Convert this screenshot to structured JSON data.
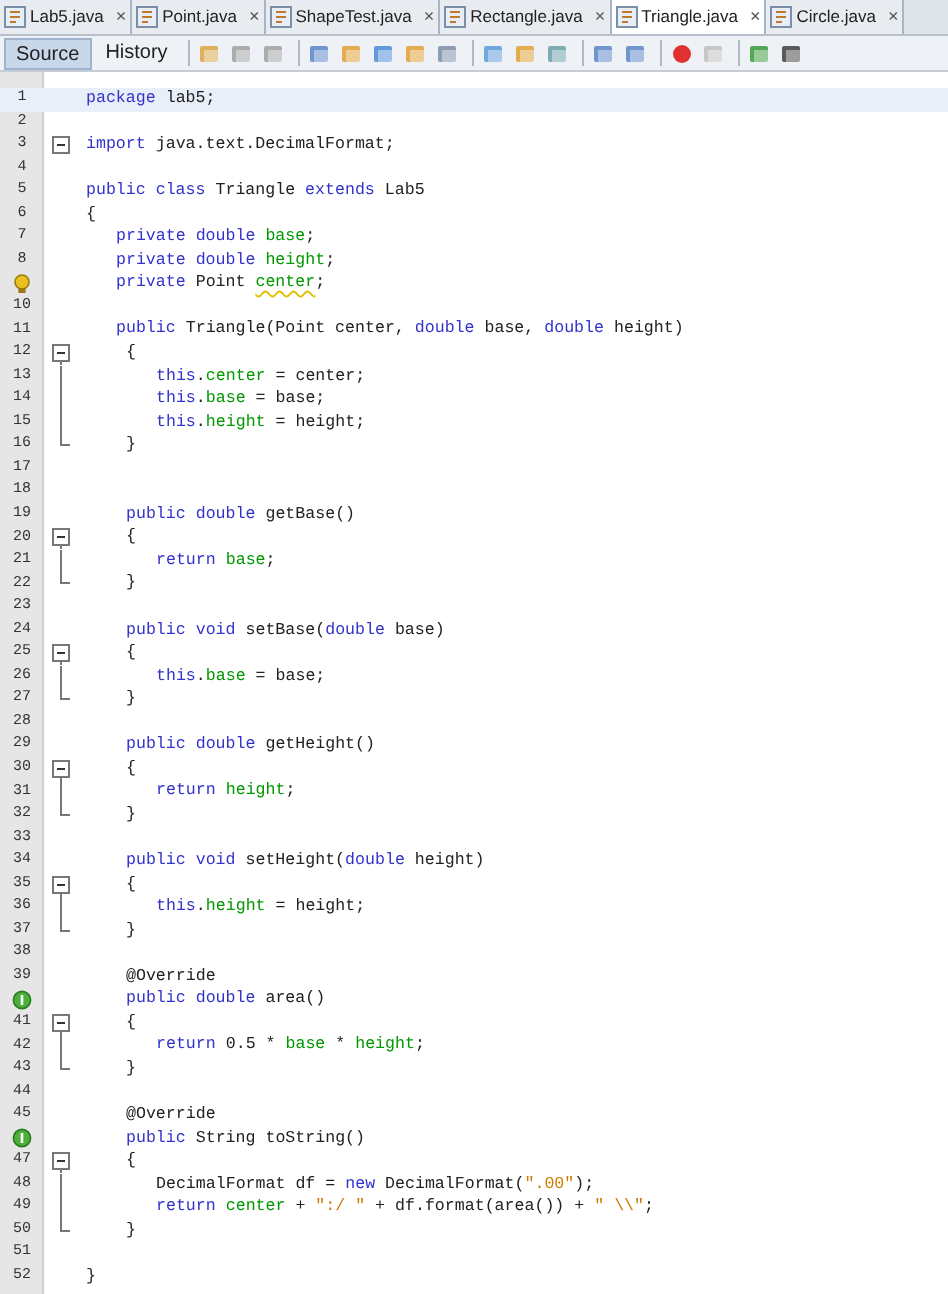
{
  "tabs": [
    {
      "label": "Lab5.java",
      "close": "×",
      "selected": false
    },
    {
      "label": "Point.java",
      "close": "×",
      "selected": false
    },
    {
      "label": "ShapeTest.java",
      "close": "×",
      "selected": false
    },
    {
      "label": "Rectangle.java",
      "close": "×",
      "selected": false
    },
    {
      "label": "Triangle.java",
      "close": "×",
      "selected": true
    },
    {
      "label": "Circle.java",
      "close": "×",
      "selected": false
    }
  ],
  "view_tabs": [
    {
      "label": "Source",
      "selected": true
    },
    {
      "label": "History",
      "selected": false
    }
  ],
  "lines": [
    {
      "number": "1",
      "current": true,
      "tokens": [
        {
          "kind": "kw",
          "text": "package "
        },
        {
          "kind": "plain",
          "text": "lab5;"
        }
      ]
    },
    {
      "number": "2",
      "current": false
    },
    {
      "number": "3",
      "current": false,
      "fold": {
        "kind": "single"
      },
      "tokens": [
        {
          "kind": "kw",
          "text": "import "
        },
        {
          "kind": "plain",
          "text": "java.text.DecimalFormat;"
        }
      ]
    },
    {
      "number": "4",
      "current": false
    },
    {
      "number": "5",
      "current": false,
      "tokens": [
        {
          "kind": "kw",
          "text": "public class "
        },
        {
          "kind": "plain",
          "text": "Triangle "
        },
        {
          "kind": "kw",
          "text": "extends "
        },
        {
          "kind": "plain",
          "text": "Lab5"
        }
      ]
    },
    {
      "number": "6",
      "current": false,
      "tokens": [
        {
          "kind": "plain",
          "text": "{"
        }
      ]
    },
    {
      "number": "7",
      "current": false,
      "indent": {
        "kind": "member"
      },
      "tokens": [
        {
          "kind": "kw",
          "text": "private double "
        },
        {
          "kind": "field",
          "text": "base"
        },
        {
          "kind": "plain",
          "text": ";"
        }
      ]
    },
    {
      "number": "8",
      "current": false,
      "indent": {
        "kind": "member"
      },
      "tokens": [
        {
          "kind": "kw",
          "text": "private double "
        },
        {
          "kind": "field",
          "text": "height"
        },
        {
          "kind": "plain",
          "text": ";"
        }
      ]
    },
    {
      "current": false,
      "marker": {
        "kind": "warning"
      },
      "indent": {
        "kind": "member"
      },
      "tokens": [
        {
          "kind": "kw",
          "text": "private "
        },
        {
          "kind": "plain",
          "text": "Point "
        },
        {
          "kind": "warn",
          "text": "center"
        },
        {
          "kind": "plain",
          "text": ";"
        }
      ]
    },
    {
      "number": "10",
      "current": false
    },
    {
      "number": "11",
      "current": false,
      "indent": {
        "kind": "member"
      },
      "tokens": [
        {
          "kind": "kw",
          "text": "public "
        },
        {
          "kind": "plain",
          "text": "Triangle(Point center, "
        },
        {
          "kind": "kw",
          "text": "double "
        },
        {
          "kind": "plain",
          "text": "base, "
        },
        {
          "kind": "kw",
          "text": "double "
        },
        {
          "kind": "plain",
          "text": "height)"
        }
      ]
    },
    {
      "number": "12",
      "current": false,
      "fold": {
        "kind": "start"
      },
      "indent": {
        "kind": "method"
      },
      "tokens": [
        {
          "kind": "plain",
          "text": "{"
        }
      ]
    },
    {
      "number": "13",
      "current": false,
      "fold": {
        "kind": "body"
      },
      "indent": {
        "kind": "body"
      },
      "tokens": [
        {
          "kind": "kw",
          "text": "this"
        },
        {
          "kind": "plain",
          "text": "."
        },
        {
          "kind": "field",
          "text": "center"
        },
        {
          "kind": "plain",
          "text": " = center;"
        }
      ]
    },
    {
      "number": "14",
      "current": false,
      "fold": {
        "kind": "body"
      },
      "indent": {
        "kind": "body"
      },
      "tokens": [
        {
          "kind": "kw",
          "text": "this"
        },
        {
          "kind": "plain",
          "text": "."
        },
        {
          "kind": "field",
          "text": "base"
        },
        {
          "kind": "plain",
          "text": " = base;"
        }
      ]
    },
    {
      "number": "15",
      "current": false,
      "fold": {
        "kind": "body"
      },
      "indent": {
        "kind": "body"
      },
      "tokens": [
        {
          "kind": "kw",
          "text": "this"
        },
        {
          "kind": "plain",
          "text": "."
        },
        {
          "kind": "field",
          "text": "height"
        },
        {
          "kind": "plain",
          "text": " = height;"
        }
      ]
    },
    {
      "number": "16",
      "current": false,
      "fold": {
        "kind": "end"
      },
      "indent": {
        "kind": "method"
      },
      "tokens": [
        {
          "kind": "plain",
          "text": "}"
        }
      ]
    },
    {
      "number": "17",
      "current": false
    },
    {
      "number": "18",
      "current": false
    },
    {
      "number": "19",
      "current": false,
      "indent": {
        "kind": "method"
      },
      "tokens": [
        {
          "kind": "kw",
          "text": "public double "
        },
        {
          "kind": "plain",
          "text": "getBase()"
        }
      ]
    },
    {
      "number": "20",
      "current": false,
      "fold": {
        "kind": "start"
      },
      "indent": {
        "kind": "method"
      },
      "tokens": [
        {
          "kind": "plain",
          "text": "{"
        }
      ]
    },
    {
      "number": "21",
      "current": false,
      "fold": {
        "kind": "body"
      },
      "indent": {
        "kind": "body"
      },
      "tokens": [
        {
          "kind": "kw",
          "text": "return "
        },
        {
          "kind": "field",
          "text": "base"
        },
        {
          "kind": "plain",
          "text": ";"
        }
      ]
    },
    {
      "number": "22",
      "current": false,
      "fold": {
        "kind": "end"
      },
      "indent": {
        "kind": "method"
      },
      "tokens": [
        {
          "kind": "plain",
          "text": "}"
        }
      ]
    },
    {
      "number": "23",
      "current": false
    },
    {
      "number": "24",
      "current": false,
      "indent": {
        "kind": "method"
      },
      "tokens": [
        {
          "kind": "kw",
          "text": "public void "
        },
        {
          "kind": "plain",
          "text": "setBase("
        },
        {
          "kind": "kw",
          "text": "double "
        },
        {
          "kind": "plain",
          "text": "base)"
        }
      ]
    },
    {
      "number": "25",
      "current": false,
      "fold": {
        "kind": "start"
      },
      "indent": {
        "kind": "method"
      },
      "tokens": [
        {
          "kind": "plain",
          "text": "{"
        }
      ]
    },
    {
      "number": "26",
      "current": false,
      "fold": {
        "kind": "body"
      },
      "indent": {
        "kind": "body"
      },
      "tokens": [
        {
          "kind": "kw",
          "text": "this"
        },
        {
          "kind": "plain",
          "text": "."
        },
        {
          "kind": "field",
          "text": "base"
        },
        {
          "kind": "plain",
          "text": " = base;"
        }
      ]
    },
    {
      "number": "27",
      "current": false,
      "fold": {
        "kind": "end"
      },
      "indent": {
        "kind": "method"
      },
      "tokens": [
        {
          "kind": "plain",
          "text": "}"
        }
      ]
    },
    {
      "number": "28",
      "current": false
    },
    {
      "number": "29",
      "current": false,
      "indent": {
        "kind": "method"
      },
      "tokens": [
        {
          "kind": "kw",
          "text": "public double "
        },
        {
          "kind": "plain",
          "text": "getHeight()"
        }
      ]
    },
    {
      "number": "30",
      "current": false,
      "fold": {
        "kind": "start"
      },
      "indent": {
        "kind": "method"
      },
      "tokens": [
        {
          "kind": "plain",
          "text": "{"
        }
      ]
    },
    {
      "number": "31",
      "current": false,
      "fold": {
        "kind": "body"
      },
      "indent": {
        "kind": "body"
      },
      "tokens": [
        {
          "kind": "kw",
          "text": "return "
        },
        {
          "kind": "field",
          "text": "height"
        },
        {
          "kind": "plain",
          "text": ";"
        }
      ]
    },
    {
      "number": "32",
      "current": false,
      "fold": {
        "kind": "end"
      },
      "indent": {
        "kind": "method"
      },
      "tokens": [
        {
          "kind": "plain",
          "text": "}"
        }
      ]
    },
    {
      "number": "33",
      "current": false
    },
    {
      "number": "34",
      "current": false,
      "indent": {
        "kind": "method"
      },
      "tokens": [
        {
          "kind": "kw",
          "text": "public void "
        },
        {
          "kind": "plain",
          "text": "setHeight("
        },
        {
          "kind": "kw",
          "text": "double "
        },
        {
          "kind": "plain",
          "text": "height)"
        }
      ]
    },
    {
      "number": "35",
      "current": false,
      "fold": {
        "kind": "start"
      },
      "indent": {
        "kind": "method"
      },
      "tokens": [
        {
          "kind": "plain",
          "text": "{"
        }
      ]
    },
    {
      "number": "36",
      "current": false,
      "fold": {
        "kind": "body"
      },
      "indent": {
        "kind": "body"
      },
      "tokens": [
        {
          "kind": "kw",
          "text": "this"
        },
        {
          "kind": "plain",
          "text": "."
        },
        {
          "kind": "field",
          "text": "height"
        },
        {
          "kind": "plain",
          "text": " = height;"
        }
      ]
    },
    {
      "number": "37",
      "current": false,
      "fold": {
        "kind": "end"
      },
      "indent": {
        "kind": "method"
      },
      "tokens": [
        {
          "kind": "plain",
          "text": "}"
        }
      ]
    },
    {
      "number": "38",
      "current": false
    },
    {
      "number": "39",
      "current": false,
      "indent": {
        "kind": "method"
      },
      "tokens": [
        {
          "kind": "plain",
          "text": "@Override"
        }
      ]
    },
    {
      "current": false,
      "marker": {
        "kind": "override"
      },
      "indent": {
        "kind": "method"
      },
      "tokens": [
        {
          "kind": "kw",
          "text": "public double "
        },
        {
          "kind": "plain",
          "text": "area()"
        }
      ]
    },
    {
      "number": "41",
      "current": false,
      "fold": {
        "kind": "start"
      },
      "indent": {
        "kind": "method"
      },
      "tokens": [
        {
          "kind": "plain",
          "text": "{"
        }
      ]
    },
    {
      "number": "42",
      "current": false,
      "fold": {
        "kind": "body"
      },
      "indent": {
        "kind": "body"
      },
      "tokens": [
        {
          "kind": "kw",
          "text": "return "
        },
        {
          "kind": "plain",
          "text": "0.5 * "
        },
        {
          "kind": "field",
          "text": "base"
        },
        {
          "kind": "plain",
          "text": " * "
        },
        {
          "kind": "field",
          "text": "height"
        },
        {
          "kind": "plain",
          "text": ";"
        }
      ]
    },
    {
      "number": "43",
      "current": false,
      "fold": {
        "kind": "end"
      },
      "indent": {
        "kind": "method"
      },
      "tokens": [
        {
          "kind": "plain",
          "text": "}"
        }
      ]
    },
    {
      "number": "44",
      "current": false
    },
    {
      "number": "45",
      "current": false,
      "indent": {
        "kind": "method"
      },
      "tokens": [
        {
          "kind": "plain",
          "text": "@Override"
        }
      ]
    },
    {
      "current": false,
      "marker": {
        "kind": "override"
      },
      "indent": {
        "kind": "method"
      },
      "tokens": [
        {
          "kind": "kw",
          "text": "public "
        },
        {
          "kind": "plain",
          "text": "String toString()"
        }
      ]
    },
    {
      "number": "47",
      "current": false,
      "fold": {
        "kind": "start"
      },
      "indent": {
        "kind": "method"
      },
      "tokens": [
        {
          "kind": "plain",
          "text": "{"
        }
      ]
    },
    {
      "number": "48",
      "current": false,
      "fold": {
        "kind": "body"
      },
      "indent": {
        "kind": "body"
      },
      "tokens": [
        {
          "kind": "plain",
          "text": "DecimalFormat df = "
        },
        {
          "kind": "kw",
          "text": "new "
        },
        {
          "kind": "plain",
          "text": "DecimalFormat("
        },
        {
          "kind": "str",
          "text": "\".00\""
        },
        {
          "kind": "plain",
          "text": ");"
        }
      ]
    },
    {
      "number": "49",
      "current": false,
      "fold": {
        "kind": "body"
      },
      "indent": {
        "kind": "body"
      },
      "tokens": [
        {
          "kind": "kw",
          "text": "return "
        },
        {
          "kind": "field",
          "text": "center"
        },
        {
          "kind": "plain",
          "text": " + "
        },
        {
          "kind": "str",
          "text": "\":/ \""
        },
        {
          "kind": "plain",
          "text": " + df.format(area()) + "
        },
        {
          "kind": "str",
          "text": "\" \\\\\""
        },
        {
          "kind": "plain",
          "text": ";"
        }
      ]
    },
    {
      "number": "50",
      "current": false,
      "fold": {
        "kind": "end"
      },
      "indent": {
        "kind": "method"
      },
      "tokens": [
        {
          "kind": "plain",
          "text": "}"
        }
      ]
    },
    {
      "number": "51",
      "current": false
    },
    {
      "number": "52",
      "current": false,
      "tokens": [
        {
          "kind": "plain",
          "text": "}"
        }
      ]
    }
  ]
}
